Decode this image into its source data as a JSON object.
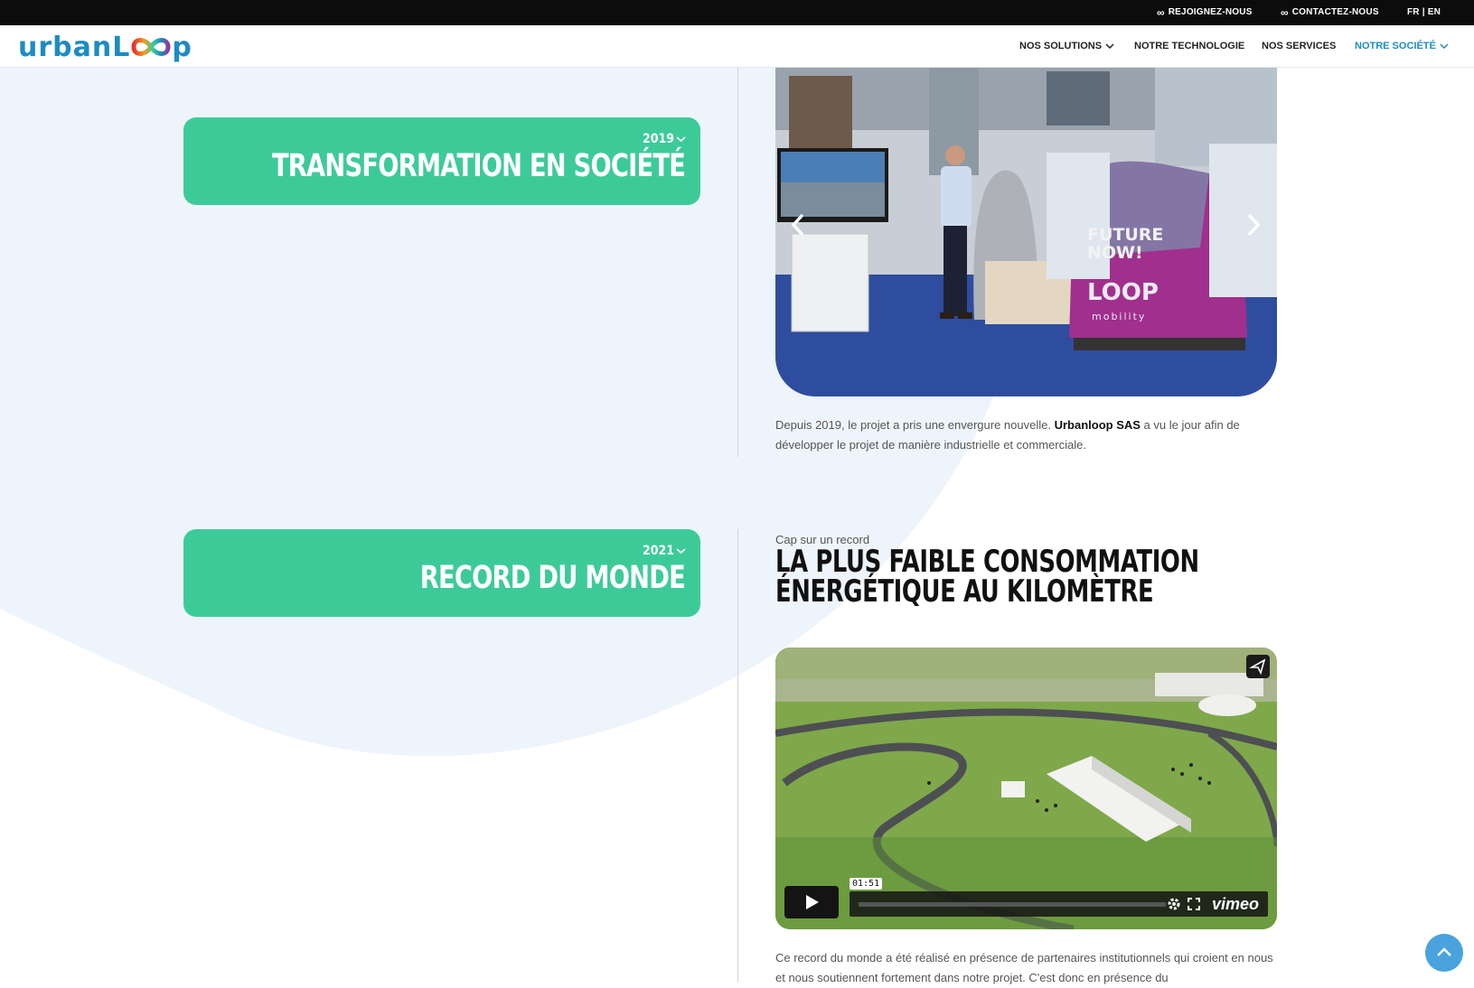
{
  "topbar": {
    "join_label": "REJOIGNEZ-NOUS",
    "contact_label": "CONTACTEZ-NOUS",
    "lang_fr": "FR",
    "lang_sep": " | ",
    "lang_en": "EN"
  },
  "header": {
    "logo_left": "urban",
    "logo_right": "p",
    "logo_mid": "L",
    "nav": [
      {
        "label": "NOS SOLUTIONS",
        "has_dropdown": true,
        "active": false
      },
      {
        "label": "NOTRE TECHNOLOGIE",
        "has_dropdown": false,
        "active": false
      },
      {
        "label": "NOS SERVICES",
        "has_dropdown": false,
        "active": false
      },
      {
        "label": "NOTRE SOCIÉTÉ",
        "has_dropdown": true,
        "active": true
      }
    ],
    "active_color": "#1d8cc2"
  },
  "timeline": [
    {
      "year": "2019",
      "title": "TRANSFORMATION EN SOCIÉTÉ",
      "image_text_1": "FUTURE",
      "image_text_2": "NOW!",
      "image_text_3": "LOOP",
      "image_text_4": "mobility",
      "text_before": "Depuis 2019, le projet a pris une envergure nouvelle. ",
      "text_bold": "Urbanloop SAS",
      "text_after": " a vu le jour afin de développer le projet de manière industrielle et commerciale."
    },
    {
      "year": "2021",
      "title": "RECORD DU MONDE",
      "kicker": "Cap sur un record",
      "heading": "LA PLUS FAIBLE CONSOMMATION ÉNERGÉTIQUE AU KILOMÈTRE",
      "video": {
        "time": "01:51",
        "brand": "vimeo",
        "progress": 0
      },
      "text": "Ce record du monde a été réalisé en présence de partenaires institutionnels qui croient en nous et nous soutiennent fortement dans notre projet. C'est donc en présence du"
    }
  ],
  "colors": {
    "card_green": "#3ccb98",
    "blob": "#eef4fb",
    "brand_blue": "#1d8cc2"
  }
}
